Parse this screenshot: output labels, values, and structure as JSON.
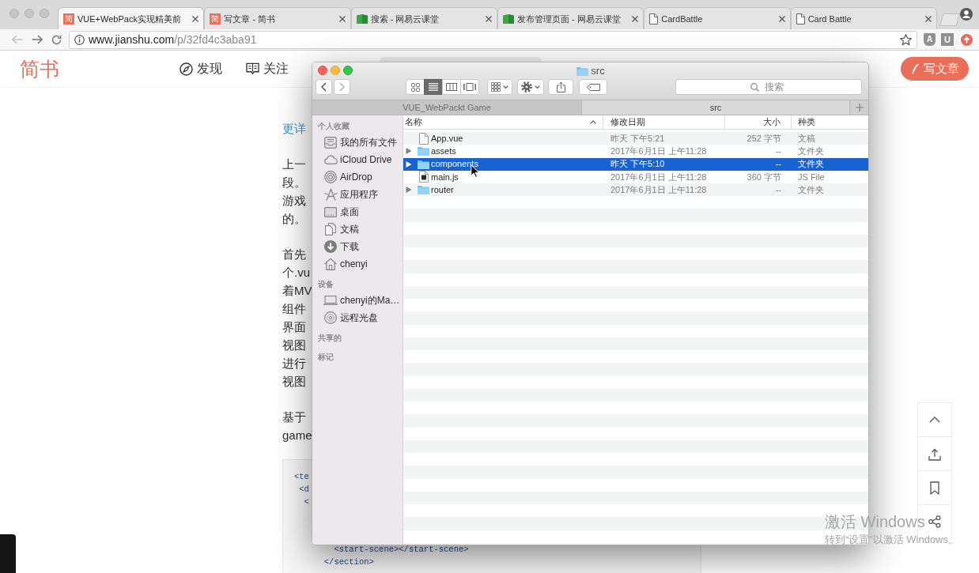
{
  "browser": {
    "tabs": [
      {
        "title": "VUE+WebPack实现精美前",
        "kind": "letter",
        "favicon_text": "简",
        "selected": true
      },
      {
        "title": "写文章 - 简书",
        "kind": "letter",
        "favicon_text": "简",
        "selected": false
      },
      {
        "title": "搜索 - 网易云课堂",
        "kind": "book",
        "selected": false
      },
      {
        "title": "发布管理页面 - 网易云课堂",
        "kind": "book",
        "selected": false
      },
      {
        "title": "CardBattle",
        "kind": "page",
        "selected": false
      },
      {
        "title": "Card Battle",
        "kind": "page",
        "selected": false
      }
    ],
    "address": {
      "host": "www.jianshu.com",
      "path": "/p/32fd4c3aba91"
    },
    "extensions": [
      {
        "kind": "shield",
        "label": "A"
      },
      {
        "kind": "square",
        "label": "U"
      },
      {
        "kind": "round"
      }
    ]
  },
  "site_header": {
    "logo": "简书",
    "nav": [
      {
        "label": "发现",
        "kind": "compass"
      },
      {
        "label": "关注",
        "kind": "book"
      }
    ],
    "write_button": "写文章"
  },
  "article": {
    "link": "更详",
    "paragraphs": [
      [
        "上一",
        "段。",
        "游戏",
        "的。"
      ],
      [
        "首先",
        "个.vu",
        "着MV",
        "组件",
        "界面",
        "视图",
        "进行",
        "视图"
      ],
      [
        "基于",
        "game"
      ]
    ],
    "code_block": {
      "lines_top": [
        "<te",
        " <d",
        "  <"
      ],
      "lines_bottom": [
        "        <start-scene></start-scene>",
        "      </section>"
      ]
    }
  },
  "side_actions": [
    {
      "kind": "top"
    },
    {
      "kind": "upload"
    },
    {
      "kind": "bookmark"
    },
    {
      "kind": "share"
    }
  ],
  "finder": {
    "title": "src",
    "tabs": [
      {
        "label": "VUE_WebPackt Game",
        "selected": false
      },
      {
        "label": "src",
        "selected": true
      }
    ],
    "view_modes": [
      {
        "kind": "icons",
        "selected": false
      },
      {
        "kind": "list",
        "selected": true
      },
      {
        "kind": "columns",
        "selected": false
      },
      {
        "kind": "gallery",
        "selected": false
      }
    ],
    "search": {
      "placeholder": "搜索"
    },
    "sidebar": [
      {
        "heading": "个人收藏",
        "items": [
          {
            "label": "我的所有文件",
            "kind": "allfiles",
            "selected": false
          },
          {
            "label": "iCloud Drive",
            "kind": "cloud",
            "selected": false
          },
          {
            "label": "AirDrop",
            "kind": "airdrop",
            "selected": false
          },
          {
            "label": "应用程序",
            "kind": "apps",
            "selected": false
          },
          {
            "label": "桌面",
            "kind": "desktop",
            "selected": false
          },
          {
            "label": "文稿",
            "kind": "documents",
            "selected": false
          },
          {
            "label": "下载",
            "kind": "downloads",
            "selected": false
          },
          {
            "label": "chenyi",
            "kind": "home",
            "selected": false
          }
        ]
      },
      {
        "heading": "设备",
        "items": [
          {
            "label": "chenyi的Ma…",
            "kind": "laptop",
            "selected": false
          },
          {
            "label": "远程光盘",
            "kind": "disc",
            "selected": false
          }
        ]
      },
      {
        "heading": "共享的"
      },
      {
        "heading": "标记"
      }
    ],
    "columns": [
      {
        "label": "名称",
        "sorted": true
      },
      {
        "label": "修改日期",
        "sorted": false
      },
      {
        "label": "大小",
        "sorted": false
      },
      {
        "label": "种类",
        "sorted": false
      }
    ],
    "files": [
      {
        "name": "App.vue",
        "kind": "document",
        "modified": "昨天 下午5:21",
        "size": "252 字节",
        "kind_label": "文稿",
        "selected": false
      },
      {
        "name": "assets",
        "kind": "folder",
        "expanded": false,
        "modified": "2017年6月1日 上午11:28",
        "size": "--",
        "kind_label": "文件夹",
        "selected": false
      },
      {
        "name": "components",
        "kind": "folder",
        "expanded": false,
        "modified": "昨天 下午5:10",
        "size": "--",
        "kind_label": "文件夹",
        "selected": true
      },
      {
        "name": "main.js",
        "kind": "script",
        "modified": "2017年6月1日 上午11:28",
        "size": "360 字节",
        "kind_label": "JS File",
        "selected": false
      },
      {
        "name": "router",
        "kind": "folder",
        "expanded": false,
        "modified": "2017年6月1日 上午11:28",
        "size": "--",
        "kind_label": "文件夹",
        "selected": false
      }
    ]
  },
  "os_notice": {
    "title": "激活 Windows",
    "detail": "转到“设置”以激活 Windows。"
  }
}
